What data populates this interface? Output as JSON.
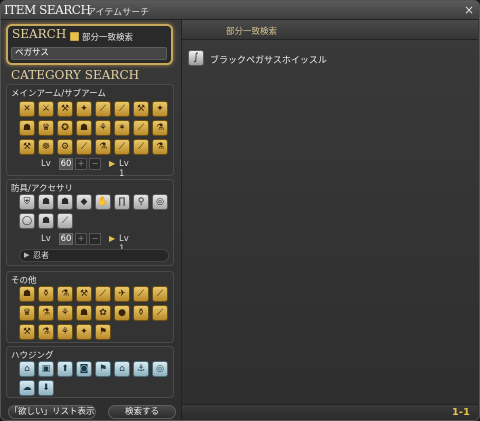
{
  "window": {
    "title": "ITEM SEARCH",
    "subtitle": "アイテムサーチ",
    "close_icon": "×"
  },
  "search": {
    "title": "SEARCH",
    "partial_match_label": "部分一致検索",
    "partial_match_checked": true,
    "query": "ペガサス"
  },
  "category": {
    "title": "CATEGORY SEARCH",
    "sections": [
      {
        "label": "メインアーム/サブアーム",
        "style": "gold",
        "icons": [
          "✕",
          "⚔",
          "⚒",
          "✦",
          "⟋",
          "⟋",
          "⚒",
          "✦",
          "☗",
          "♛",
          "✪",
          "☗",
          "⚘",
          "✶",
          "⟋",
          "⚗",
          "⚒",
          "☸",
          "⚙",
          "⟋",
          "⚗",
          "⟋",
          "⟋",
          "⚗"
        ],
        "lv": {
          "label": "Lv",
          "value": "60",
          "plus": "+",
          "minus": "−",
          "arrow": "▶",
          "max": "Lv 1"
        }
      },
      {
        "label": "防具/アクセサリ",
        "style": "silver",
        "icons": [
          "⛨",
          "☗",
          "☗",
          "◆",
          "✋",
          "∏",
          "⚲",
          "◎",
          "◯",
          "☗",
          "⟋"
        ],
        "lv": {
          "label": "Lv",
          "value": "60",
          "plus": "+",
          "minus": "−",
          "arrow": "▶",
          "max": "Lv 1"
        },
        "job": {
          "arrow": "▶",
          "value": "忍者"
        }
      },
      {
        "label": "その他",
        "style": "gold",
        "icons": [
          "☗",
          "⚱",
          "⚗",
          "⚒",
          "⟋",
          "✈",
          "⟋",
          "⟋",
          "♛",
          "⚗",
          "⚘",
          "☗",
          "✿",
          "●",
          "⚱",
          "⟋",
          "⚒",
          "⚗",
          "⚘",
          "✦",
          "⚑"
        ],
        "lv": null
      },
      {
        "label": "ハウジング",
        "style": "blue",
        "icons": [
          "⌂",
          "▣",
          "⬆",
          "◙",
          "⚑",
          "⌂",
          "⚓",
          "◎",
          "☁",
          "⬇"
        ],
        "lv": null
      }
    ]
  },
  "buttons": {
    "wishlist": "「欲しい」リスト表示",
    "search": "検索する"
  },
  "results": {
    "header": "部分一致検索",
    "items": [
      {
        "icon": "∫",
        "name": "ブラックペガサスホイッスル"
      }
    ],
    "page_count": "1-1"
  }
}
